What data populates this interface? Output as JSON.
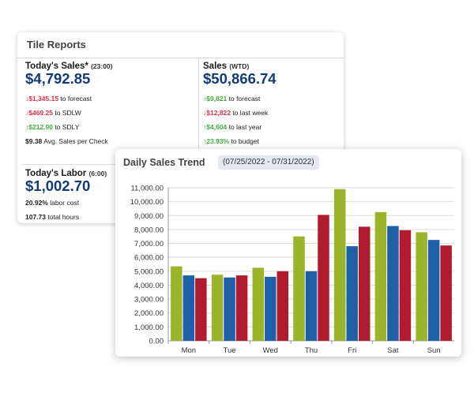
{
  "tile_reports": {
    "title": "Tile Reports",
    "todays_sales": {
      "label": "Today's Sales*",
      "time": "(23:00)",
      "value": "$4,792.85",
      "lines": [
        {
          "arrow": "↓",
          "amount": "$1,345.15",
          "text": "to forecast",
          "color": "red"
        },
        {
          "arrow": "↓",
          "amount": "$469.25",
          "text": "to SDLW",
          "color": "red"
        },
        {
          "arrow": "↑",
          "amount": "$212.90",
          "text": "to SDLY",
          "color": "green"
        },
        {
          "arrow": "",
          "amount": "$9.38",
          "text": "Avg. Sales per Check",
          "color": "dark"
        }
      ]
    },
    "sales_wtd": {
      "label": "Sales",
      "time": "(WTD)",
      "value": "$50,866.74",
      "lines": [
        {
          "arrow": "↑",
          "amount": "$9,821",
          "text": "to forecast",
          "color": "green"
        },
        {
          "arrow": "↓",
          "amount": "$12,822",
          "text": "to last week",
          "color": "red"
        },
        {
          "arrow": "↑",
          "amount": "$4,604",
          "text": "to last year",
          "color": "green"
        },
        {
          "arrow": "↑",
          "amount": "23.93%",
          "text": "to budget",
          "color": "green"
        }
      ]
    },
    "todays_labor": {
      "label": "Today's Labor",
      "time": "(6:00)",
      "value": "$1,002.70",
      "lines": [
        {
          "arrow": "",
          "amount": "20.92%",
          "text": "labor cost",
          "color": "dark"
        },
        {
          "arrow": "",
          "amount": "107.73",
          "text": "total hours",
          "color": "dark"
        }
      ]
    }
  },
  "daily_sales_trend": {
    "title": "Daily Sales Trend",
    "date_range": "(07/25/2022 - 07/31/2022)"
  },
  "colors": {
    "series_green": "#9ab52a",
    "series_blue": "#1f5fa8",
    "series_red": "#b01c2e",
    "value_blue": "#123a73"
  },
  "chart_data": {
    "type": "bar",
    "categories": [
      "Mon",
      "Tue",
      "Wed",
      "Thu",
      "Fri",
      "Sat",
      "Sun"
    ],
    "series": [
      {
        "values": [
          5350,
          4750,
          5250,
          7500,
          10900,
          9250,
          7800
        ]
      },
      {
        "values": [
          4700,
          4550,
          4600,
          5000,
          6800,
          8250,
          7250
        ]
      },
      {
        "values": [
          4500,
          4700,
          5000,
          9050,
          8200,
          7950,
          6850
        ]
      }
    ],
    "ylim": [
      0,
      11000
    ],
    "yticks": [
      "11,000.00",
      "10,000.00",
      "9,000.00",
      "8,000.00",
      "7,000.00",
      "6,000.00",
      "5,000.00",
      "4,000.00",
      "3,000.00",
      "2,000.00",
      "1,000.00",
      "0.00"
    ],
    "grid": true
  }
}
